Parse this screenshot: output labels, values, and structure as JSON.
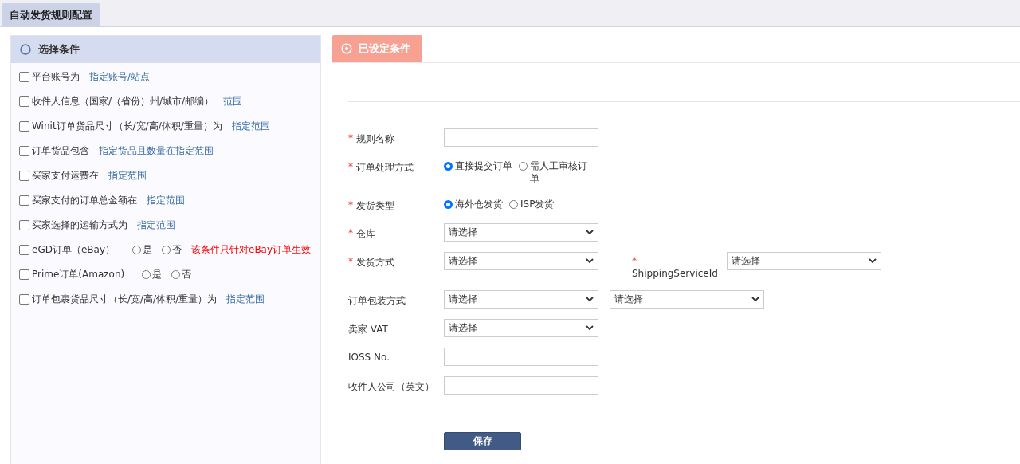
{
  "page_tab": {
    "label": "自动发货规则配置",
    "selected": true
  },
  "conditions_panel": {
    "title": "选择条件",
    "items": [
      {
        "kind": "link",
        "checked": false,
        "label": "平台账号为",
        "link": "指定账号/站点"
      },
      {
        "kind": "link",
        "checked": false,
        "label": "收件人信息（国家/（省份）州/城市/邮编）",
        "link": "范围"
      },
      {
        "kind": "link",
        "checked": false,
        "label": "Winit订单货品尺寸（长/宽/高/体积/重量）为",
        "link": "指定范围"
      },
      {
        "kind": "link",
        "checked": false,
        "label": "订单货品包含",
        "link": "指定货品且数量在指定范围"
      },
      {
        "kind": "link",
        "checked": false,
        "label": "买家支付运费在",
        "link": "指定范围"
      },
      {
        "kind": "link",
        "checked": false,
        "label": "买家支付的订单总金额在",
        "link": "指定范围"
      },
      {
        "kind": "link",
        "checked": false,
        "label": "买家选择的运输方式为",
        "link": "指定范围"
      },
      {
        "kind": "radio",
        "checked": false,
        "label": "eGD订单（eBay）",
        "options": [
          {
            "label": "是",
            "selected": false
          },
          {
            "label": "否",
            "selected": false
          }
        ],
        "note": "该条件只针对eBay订单生效"
      },
      {
        "kind": "radio",
        "checked": false,
        "label": "Prime订单(Amazon)",
        "options": [
          {
            "label": "是",
            "selected": false
          },
          {
            "label": "否",
            "selected": false
          }
        ]
      },
      {
        "kind": "link",
        "checked": false,
        "label": "订单包裹货品尺寸（长/宽/高/体积/重量）为",
        "link": "指定范围"
      }
    ]
  },
  "set_panel": {
    "title": "已设定条件"
  },
  "form": {
    "rows": [
      {
        "mark": "*",
        "label": "规则名称",
        "controls": [
          {
            "kind": "text"
          }
        ]
      },
      {
        "mark": "*",
        "label": "订单处理方式",
        "controls": [
          {
            "kind": "radio",
            "options": [
              {
                "label": "直接提交订单",
                "selected": true
              },
              {
                "label": "需人工审核订单",
                "selected": false
              }
            ]
          }
        ]
      },
      {
        "mark": "*",
        "label": "发货类型",
        "controls": [
          {
            "kind": "radio",
            "options": [
              {
                "label": "海外仓发货",
                "selected": true
              },
              {
                "label": "ISP发货",
                "selected": false
              }
            ]
          }
        ]
      },
      {
        "mark": "*",
        "label": "仓库",
        "controls": [
          {
            "kind": "select",
            "value": "请选择"
          }
        ]
      },
      {
        "mark": "*",
        "label": "发货方式",
        "controls": [
          {
            "kind": "select",
            "value": "请选择"
          },
          {
            "kind": "labeled_select",
            "mark": "*",
            "label": "ShippingServiceId",
            "value": "请选择"
          }
        ]
      },
      {
        "label": "订单包装方式",
        "controls": [
          {
            "kind": "select",
            "value": "请选择"
          },
          {
            "kind": "select",
            "value": "请选择"
          }
        ]
      },
      {
        "label": "卖家 VAT",
        "controls": [
          {
            "kind": "select",
            "value": "请选择"
          }
        ]
      },
      {
        "label": "IOSS No.",
        "controls": [
          {
            "kind": "text"
          }
        ]
      },
      {
        "label": "收件人公司（英文）",
        "controls": [
          {
            "kind": "text"
          }
        ]
      }
    ],
    "save_button": "保存"
  }
}
